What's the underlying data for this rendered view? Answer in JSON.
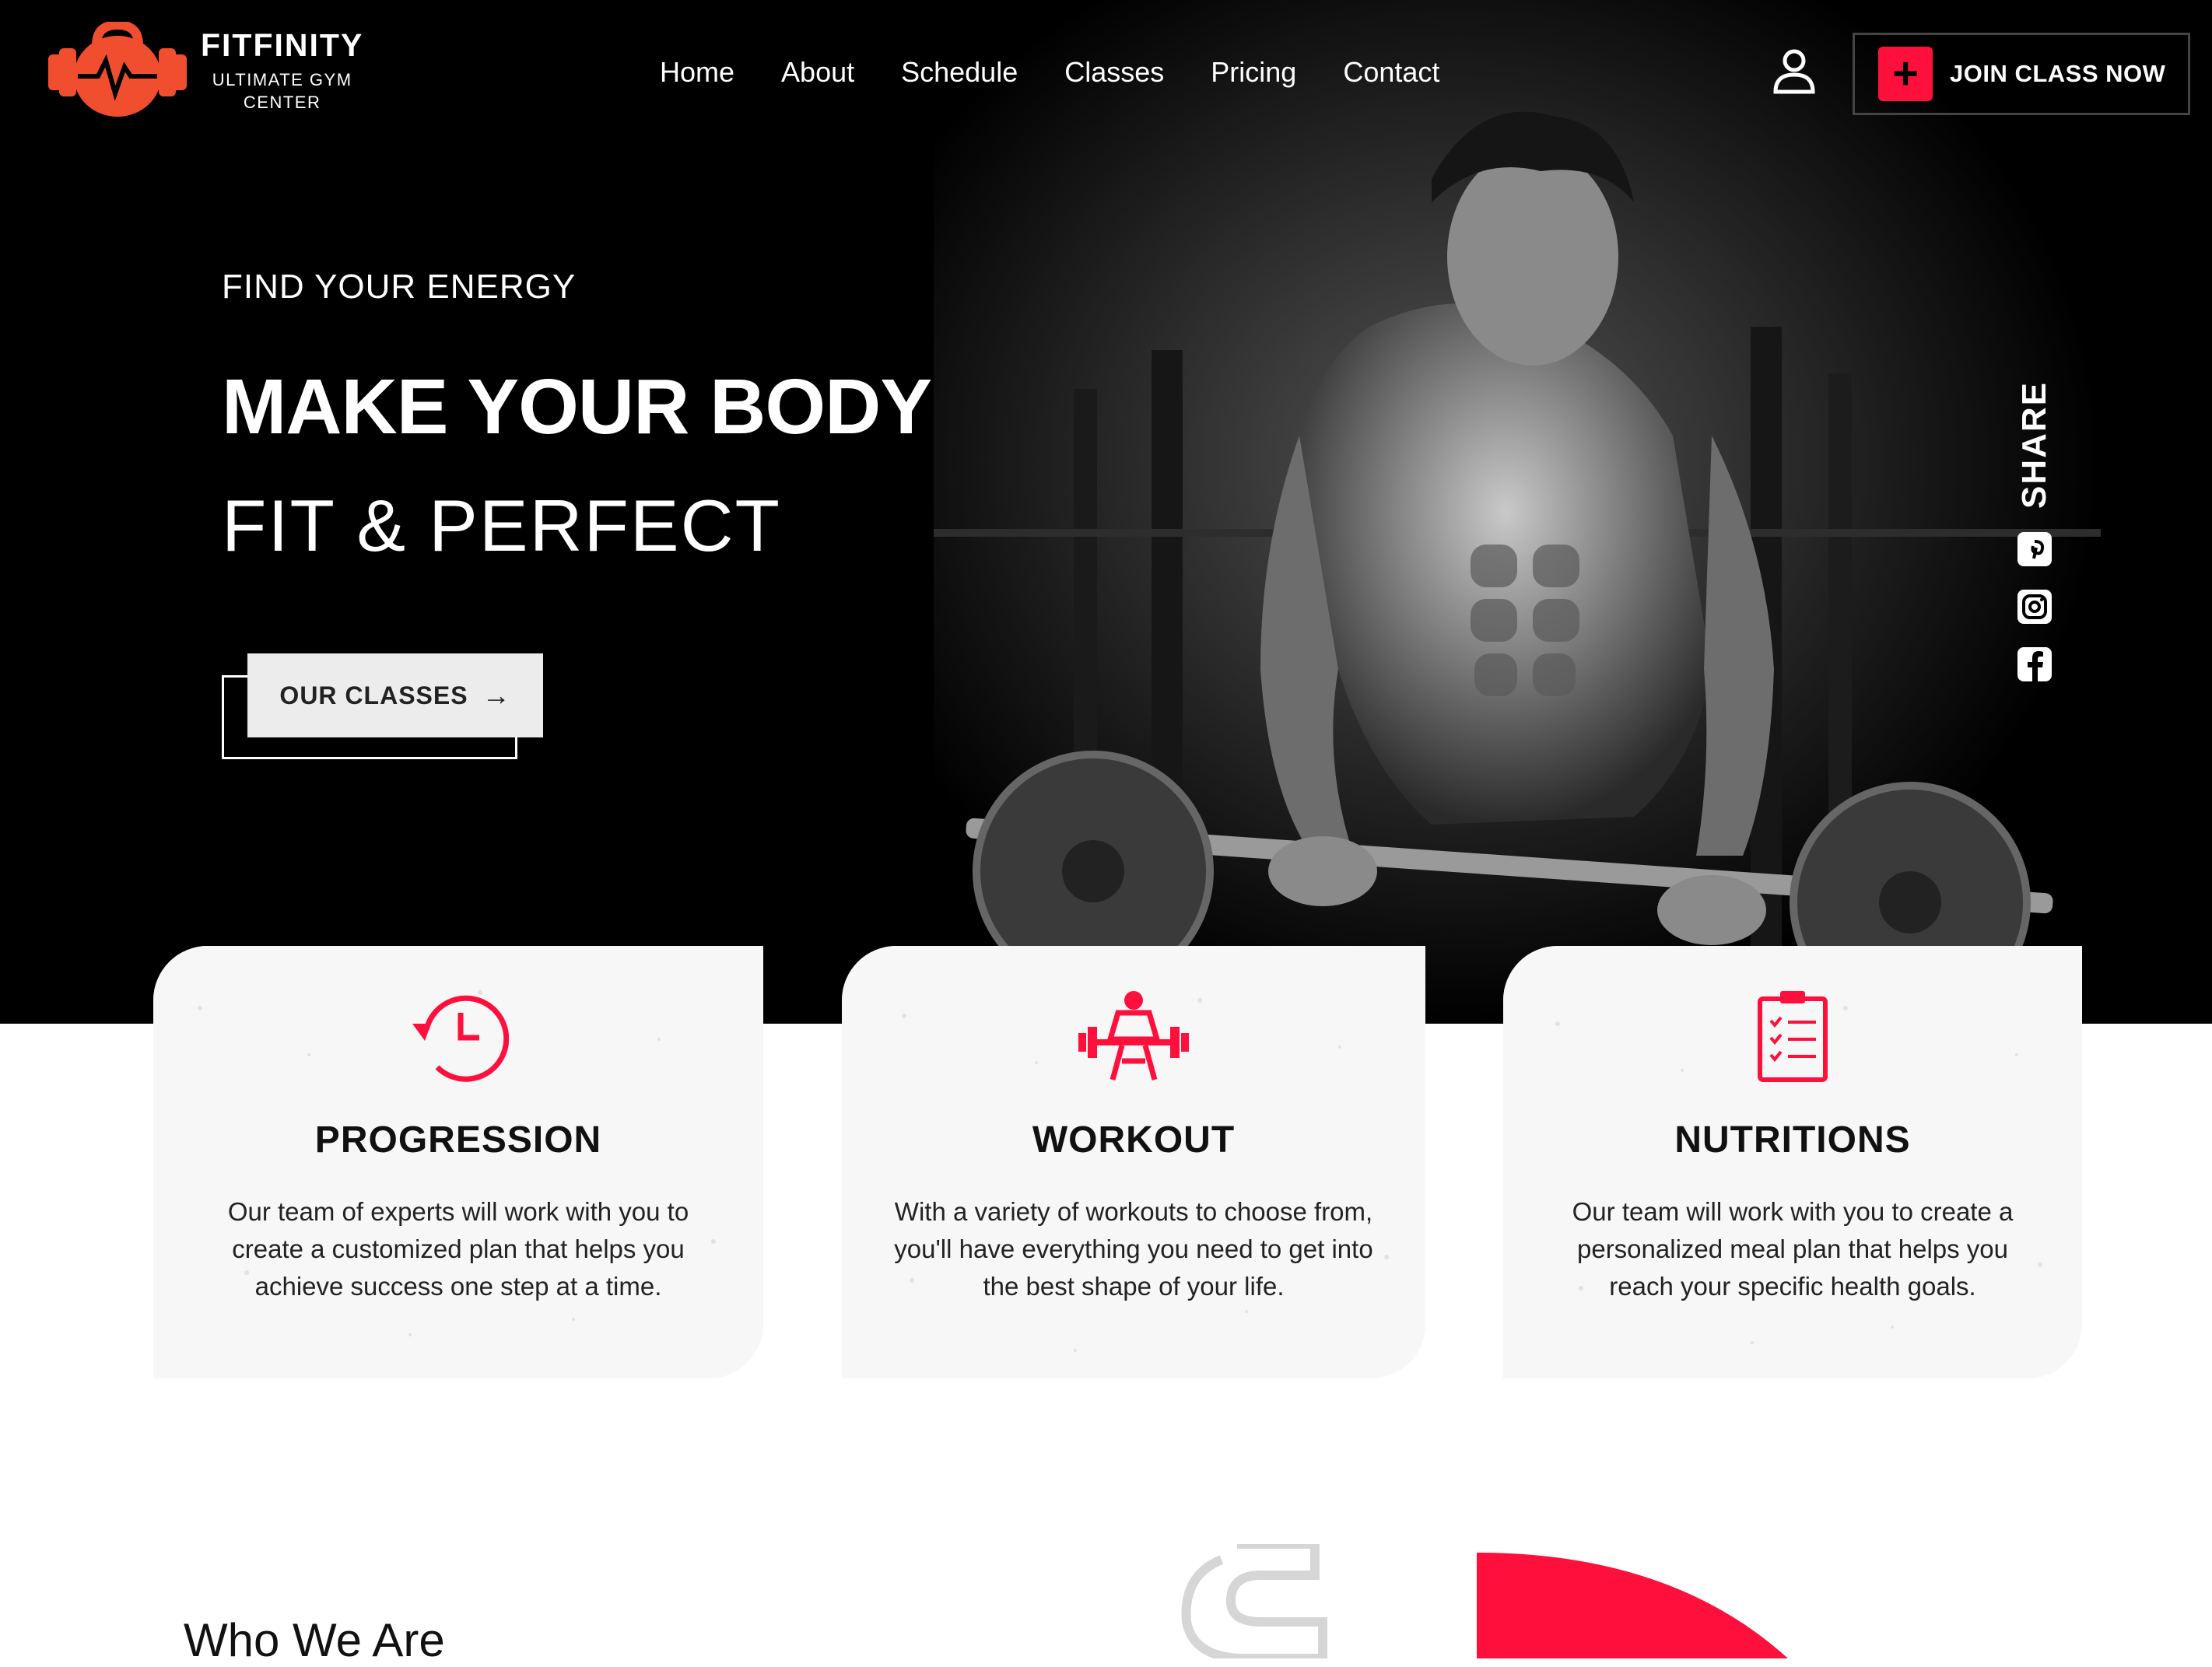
{
  "brand": {
    "name": "FITFINITY",
    "tagline_line1": "ULTIMATE GYM",
    "tagline_line2": "CENTER"
  },
  "nav": {
    "items": [
      "Home",
      "About",
      "Schedule",
      "Classes",
      "Pricing",
      "Contact"
    ]
  },
  "header": {
    "join_label": "JOIN CLASS NOW",
    "join_icon": "plus-icon",
    "user_icon": "user-icon"
  },
  "hero": {
    "eyebrow": "FIND YOUR ENERGY",
    "title_line1": "MAKE YOUR BODY",
    "title_line2": "FIT & PERFECT",
    "cta_label": "OUR CLASSES"
  },
  "share": {
    "label": "SHARE",
    "icons": [
      "pinterest-icon",
      "instagram-icon",
      "facebook-icon"
    ]
  },
  "features": [
    {
      "icon": "clock-history-icon",
      "title": "PROGRESSION",
      "text": "Our team of experts will work with you to create a customized plan that helps you achieve success one step at a time."
    },
    {
      "icon": "weightlifter-icon",
      "title": "WORKOUT",
      "text": "With a variety of workouts to choose from, you'll have everything you need to get into the best shape of your life."
    },
    {
      "icon": "checklist-icon",
      "title": "NUTRITIONS",
      "text": "Our team will work with you to create a personalized meal plan that helps you reach your specific health goals."
    }
  ],
  "about": {
    "heading": "Who We Are"
  },
  "colors": {
    "accent": "#ff0f3b",
    "logo": "#f04e2f",
    "hero_bg": "#000000"
  }
}
